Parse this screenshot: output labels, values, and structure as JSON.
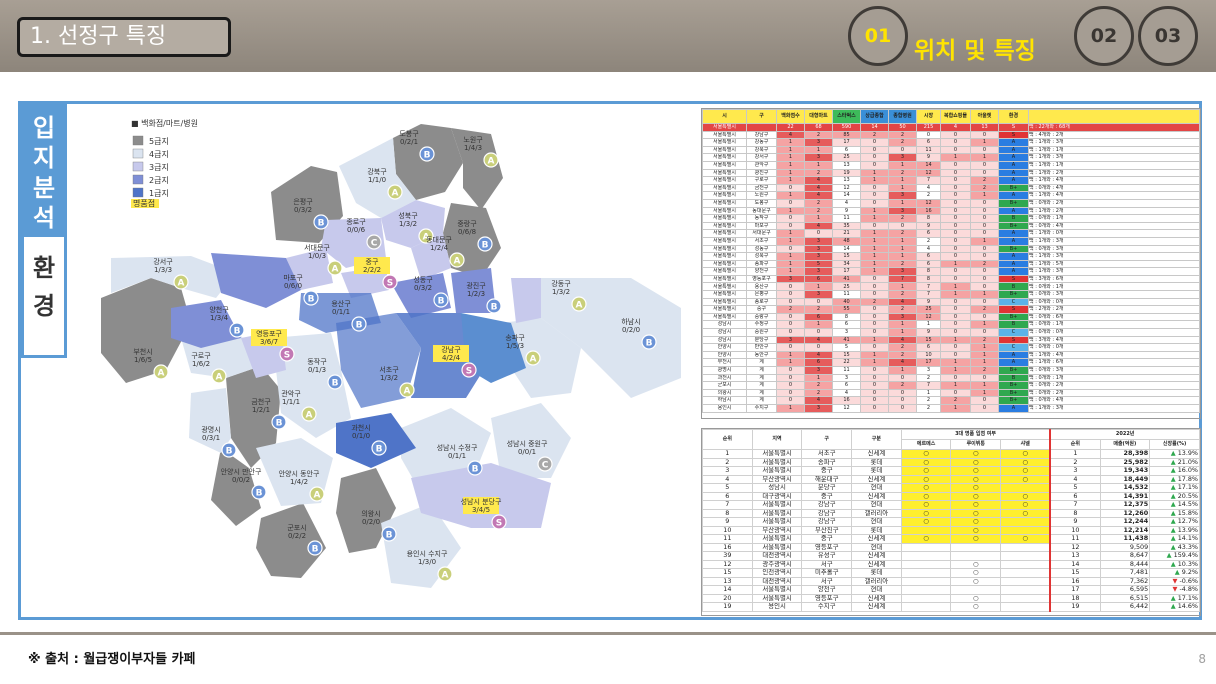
{
  "header": {
    "title": "1. 선정구 특징",
    "steps": [
      "01",
      "02",
      "03"
    ],
    "active_label": "위치 및 특징"
  },
  "side_tabs": [
    "입지분석",
    "환경"
  ],
  "legend": {
    "title": "■ 백화점/마트/병원",
    "levels": [
      {
        "label": "5급지",
        "color": "#8c8c8c"
      },
      {
        "label": "4급지",
        "color": "#dbe4f0"
      },
      {
        "label": "3급지",
        "color": "#c7c9ec"
      },
      {
        "label": "2급지",
        "color": "#7f8fd6"
      },
      {
        "label": "1급지",
        "color": "#4f74c8"
      }
    ],
    "selected": "명품점"
  },
  "districts": [
    {
      "name": "도봉구",
      "counts": "0/2/1",
      "grade": "B"
    },
    {
      "name": "노원구",
      "counts": "1/4/3",
      "grade": "A"
    },
    {
      "name": "강북구",
      "counts": "1/1/0",
      "grade": "A"
    },
    {
      "name": "은평구",
      "counts": "0/3/2",
      "grade": "B"
    },
    {
      "name": "성북구",
      "counts": "1/3/2",
      "grade": "A"
    },
    {
      "name": "중랑구",
      "counts": "0/6/8",
      "grade": "B"
    },
    {
      "name": "종로구",
      "counts": "0/0/6",
      "grade": "C"
    },
    {
      "name": "동대문구",
      "counts": "1/2/4",
      "grade": "A"
    },
    {
      "name": "서대문구",
      "counts": "1/0/3",
      "grade": "A"
    },
    {
      "name": "중구",
      "counts": "2/2/2",
      "grade": "S"
    },
    {
      "name": "강서구",
      "counts": "1/3/3",
      "grade": "A"
    },
    {
      "name": "마포구",
      "counts": "0/6/0",
      "grade": "B"
    },
    {
      "name": "성동구",
      "counts": "0/3/2",
      "grade": "B"
    },
    {
      "name": "광진구",
      "counts": "1/2/3",
      "grade": "B"
    },
    {
      "name": "강동구",
      "counts": "1/3/2",
      "grade": "A"
    },
    {
      "name": "용산구",
      "counts": "0/1/1",
      "grade": "B"
    },
    {
      "name": "하남시",
      "counts": "0/2/0",
      "grade": "B"
    },
    {
      "name": "양천구",
      "counts": "1/3/4",
      "grade": "B"
    },
    {
      "name": "영등포구",
      "counts": "3/6/7",
      "grade": "S"
    },
    {
      "name": "부천시",
      "counts": "1/6/5",
      "grade": "A"
    },
    {
      "name": "구로구",
      "counts": "1/6/2",
      "grade": "A"
    },
    {
      "name": "동작구",
      "counts": "0/1/3",
      "grade": "B"
    },
    {
      "name": "송파구",
      "counts": "1/5/3",
      "grade": "A"
    },
    {
      "name": "강남구",
      "counts": "4/2/4",
      "grade": "S"
    },
    {
      "name": "서초구",
      "counts": "1/3/2",
      "grade": "A"
    },
    {
      "name": "관악구",
      "counts": "1/1/1",
      "grade": "A"
    },
    {
      "name": "광명시",
      "counts": "0/3/1",
      "grade": "B"
    },
    {
      "name": "금천구",
      "counts": "1/2/1",
      "grade": "B"
    },
    {
      "name": "과천시",
      "counts": "0/1/0",
      "grade": "B"
    },
    {
      "name": "안양시 만안구",
      "counts": "0/0/2",
      "grade": "B"
    },
    {
      "name": "안양시 동안구",
      "counts": "1/4/2",
      "grade": "A"
    },
    {
      "name": "성남시 수정구",
      "counts": "0/1/1",
      "grade": "B"
    },
    {
      "name": "성남시 중원구",
      "counts": "0/0/1",
      "grade": "C"
    },
    {
      "name": "성남시 분당구",
      "counts": "3/4/5",
      "grade": "S"
    },
    {
      "name": "의왕시",
      "counts": "0/2/0",
      "grade": "B"
    },
    {
      "name": "군포시",
      "counts": "0/2/2",
      "grade": "B"
    },
    {
      "name": "용인시 수지구",
      "counts": "1/3/0",
      "grade": "A"
    }
  ],
  "table1": {
    "headers": [
      "시",
      "구",
      "백화점수",
      "대형마트",
      "스타벅스",
      "상급종합",
      "종합병원",
      "시장",
      "복합쇼핑몰",
      "아울렛",
      "환경",
      ""
    ],
    "rows": [
      [
        "서울특별시",
        "",
        "22",
        "68",
        "590",
        "14",
        "50",
        "215",
        "4",
        "13",
        "S",
        "백 : 22개와 : 68개"
      ],
      [
        "서울특별시",
        "강남구",
        "4",
        "2",
        "85",
        "2",
        "2",
        "0",
        "0",
        "0",
        "S",
        "백 : 4개와 : 2개"
      ],
      [
        "서울특별시",
        "강동구",
        "1",
        "3",
        "17",
        "0",
        "2",
        "6",
        "0",
        "1",
        "A",
        "백 : 1개와 : 3개"
      ],
      [
        "서울특별시",
        "강북구",
        "1",
        "1",
        "6",
        "0",
        "0",
        "11",
        "0",
        "0",
        "A",
        "백 : 1개와 : 1개"
      ],
      [
        "서울특별시",
        "강서구",
        "1",
        "3",
        "25",
        "0",
        "3",
        "9",
        "1",
        "1",
        "A",
        "백 : 1개와 : 3개"
      ],
      [
        "서울특별시",
        "관악구",
        "1",
        "1",
        "13",
        "0",
        "1",
        "14",
        "0",
        "0",
        "A",
        "백 : 1개와 : 1개"
      ],
      [
        "서울특별시",
        "광진구",
        "1",
        "2",
        "19",
        "1",
        "2",
        "12",
        "0",
        "0",
        "A",
        "백 : 1개와 : 2개"
      ],
      [
        "서울특별시",
        "구로구",
        "1",
        "4",
        "13",
        "1",
        "1",
        "7",
        "0",
        "2",
        "A",
        "백 : 1개와 : 4개"
      ],
      [
        "서울특별시",
        "금천구",
        "0",
        "4",
        "12",
        "0",
        "1",
        "4",
        "0",
        "2",
        "B+",
        "백 : 0개와 : 4개"
      ],
      [
        "서울특별시",
        "노원구",
        "1",
        "4",
        "14",
        "0",
        "3",
        "2",
        "0",
        "1",
        "A",
        "백 : 1개와 : 4개"
      ],
      [
        "서울특별시",
        "도봉구",
        "0",
        "2",
        "4",
        "0",
        "1",
        "12",
        "0",
        "0",
        "B+",
        "백 : 0개와 : 2개"
      ],
      [
        "서울특별시",
        "동대문구",
        "1",
        "2",
        "9",
        "1",
        "3",
        "16",
        "0",
        "0",
        "A",
        "백 : 1개와 : 2개"
      ],
      [
        "서울특별시",
        "동작구",
        "0",
        "1",
        "11",
        "1",
        "2",
        "8",
        "0",
        "0",
        "B",
        "백 : 0개와 : 1개"
      ],
      [
        "서울특별시",
        "마포구",
        "0",
        "4",
        "35",
        "0",
        "0",
        "9",
        "0",
        "0",
        "B+",
        "백 : 0개와 : 4개"
      ],
      [
        "서울특별시",
        "서대문구",
        "1",
        "0",
        "21",
        "1",
        "2",
        "6",
        "0",
        "0",
        "A",
        "백 : 1개와 : 0개"
      ],
      [
        "서울특별시",
        "서초구",
        "1",
        "3",
        "48",
        "1",
        "1",
        "2",
        "0",
        "1",
        "A",
        "백 : 1개와 : 3개"
      ],
      [
        "서울특별시",
        "성동구",
        "0",
        "3",
        "14",
        "1",
        "1",
        "4",
        "0",
        "0",
        "B+",
        "백 : 0개와 : 3개"
      ],
      [
        "서울특별시",
        "성북구",
        "1",
        "3",
        "15",
        "1",
        "1",
        "6",
        "0",
        "0",
        "A",
        "백 : 1개와 : 3개"
      ],
      [
        "서울특별시",
        "송파구",
        "1",
        "5",
        "34",
        "1",
        "2",
        "6",
        "1",
        "2",
        "A",
        "백 : 1개와 : 5개"
      ],
      [
        "서울특별시",
        "양천구",
        "1",
        "3",
        "17",
        "1",
        "3",
        "8",
        "0",
        "0",
        "A",
        "백 : 1개와 : 3개"
      ],
      [
        "서울특별시",
        "영등포구",
        "3",
        "6",
        "41",
        "0",
        "7",
        "8",
        "0",
        "0",
        "S",
        "백 : 3개와 : 6개"
      ],
      [
        "서울특별시",
        "용산구",
        "0",
        "1",
        "25",
        "0",
        "1",
        "7",
        "1",
        "0",
        "B",
        "백 : 0개와 : 1개"
      ],
      [
        "서울특별시",
        "은평구",
        "0",
        "3",
        "11",
        "0",
        "2",
        "7",
        "1",
        "1",
        "B+",
        "백 : 0개와 : 3개"
      ],
      [
        "서울특별시",
        "종로구",
        "0",
        "0",
        "40",
        "2",
        "4",
        "9",
        "0",
        "0",
        "C",
        "백 : 0개와 : 0개"
      ],
      [
        "서울특별시",
        "중구",
        "2",
        "2",
        "55",
        "0",
        "2",
        "25",
        "0",
        "2",
        "S",
        "백 : 2개와 : 2개"
      ],
      [
        "서울특별시",
        "중랑구",
        "0",
        "6",
        "8",
        "0",
        "3",
        "12",
        "0",
        "0",
        "B+",
        "백 : 0개와 : 6개"
      ],
      [
        "성남시",
        "수정구",
        "0",
        "1",
        "6",
        "0",
        "1",
        "1",
        "0",
        "1",
        "B",
        "백 : 0개와 : 1개"
      ],
      [
        "성남시",
        "중원구",
        "0",
        "0",
        "3",
        "0",
        "1",
        "9",
        "0",
        "0",
        "C",
        "백 : 0개와 : 0개"
      ],
      [
        "성남시",
        "분당구",
        "3",
        "4",
        "41",
        "1",
        "4",
        "15",
        "1",
        "2",
        "S",
        "백 : 3개와 : 4개"
      ],
      [
        "안양시",
        "만안구",
        "0",
        "0",
        "5",
        "0",
        "2",
        "6",
        "0",
        "1",
        "C",
        "백 : 0개와 : 0개"
      ],
      [
        "안양시",
        "동안구",
        "1",
        "4",
        "15",
        "1",
        "2",
        "10",
        "0",
        "1",
        "A",
        "백 : 1개와 : 4개"
      ],
      [
        "부천시",
        "계",
        "1",
        "6",
        "22",
        "1",
        "4",
        "17",
        "1",
        "1",
        "A",
        "백 : 1개와 : 6개"
      ],
      [
        "광명시",
        "계",
        "0",
        "3",
        "11",
        "0",
        "1",
        "3",
        "1",
        "2",
        "B+",
        "백 : 0개와 : 3개"
      ],
      [
        "과천시",
        "계",
        "0",
        "1",
        "3",
        "0",
        "0",
        "2",
        "0",
        "0",
        "B",
        "백 : 0개와 : 1개"
      ],
      [
        "군포시",
        "계",
        "0",
        "2",
        "6",
        "0",
        "2",
        "7",
        "1",
        "1",
        "B+",
        "백 : 0개와 : 2개"
      ],
      [
        "의왕시",
        "계",
        "0",
        "2",
        "4",
        "0",
        "0",
        "1",
        "0",
        "1",
        "B+",
        "백 : 0개와 : 2개"
      ],
      [
        "하남시",
        "계",
        "0",
        "4",
        "16",
        "0",
        "0",
        "2",
        "2",
        "0",
        "B+",
        "백 : 0개와 : 4개"
      ],
      [
        "용인시",
        "수지구",
        "1",
        "3",
        "12",
        "0",
        "0",
        "2",
        "1",
        "0",
        "A",
        "백 : 1개와 : 3개"
      ]
    ]
  },
  "table2": {
    "group_header": "3대 명품 입점 여부",
    "year_header": "2022년",
    "headers": [
      "순위",
      "지역",
      "구",
      "구분",
      "에르메스",
      "루이뷔통",
      "샤넬",
      "순위",
      "매출(억원)",
      "신장률(%)"
    ],
    "mark": "○",
    "rows": [
      [
        "1",
        "서울특별시",
        "서초구",
        "신세계",
        "○",
        "○",
        "○",
        "1",
        "28,398",
        "13.9%",
        "up"
      ],
      [
        "2",
        "서울특별시",
        "송파구",
        "롯데",
        "○",
        "○",
        "○",
        "2",
        "25,982",
        "21.0%",
        "up"
      ],
      [
        "3",
        "서울특별시",
        "중구",
        "롯데",
        "○",
        "○",
        "○",
        "3",
        "19,343",
        "16.0%",
        "up"
      ],
      [
        "4",
        "부산광역시",
        "해운대구",
        "신세계",
        "○",
        "○",
        "○",
        "4",
        "18,449",
        "17.8%",
        "up"
      ],
      [
        "5",
        "성남시",
        "분당구",
        "현대",
        "○",
        "○",
        "",
        "5",
        "14,532",
        "17.1%",
        "up"
      ],
      [
        "6",
        "대구광역시",
        "중구",
        "신세계",
        "○",
        "○",
        "○",
        "6",
        "14,391",
        "20.5%",
        "up"
      ],
      [
        "7",
        "서울특별시",
        "강남구",
        "현대",
        "○",
        "○",
        "○",
        "7",
        "12,375",
        "14.5%",
        "up"
      ],
      [
        "8",
        "서울특별시",
        "강남구",
        "갤러리아",
        "○",
        "○",
        "○",
        "8",
        "12,260",
        "15.8%",
        "up"
      ],
      [
        "9",
        "서울특별시",
        "강남구",
        "현대",
        "○",
        "○",
        "",
        "9",
        "12,244",
        "12.7%",
        "up"
      ],
      [
        "10",
        "부산광역시",
        "부산진구",
        "롯데",
        "",
        "○",
        "",
        "10",
        "12,214",
        "13.9%",
        "up"
      ],
      [
        "11",
        "서울특별시",
        "중구",
        "신세계",
        "○",
        "○",
        "○",
        "11",
        "11,438",
        "14.1%",
        "up"
      ],
      [
        "16",
        "서울특별시",
        "영등포구",
        "현대",
        "",
        "",
        "",
        "12",
        "9,509",
        "43.3%",
        "up"
      ],
      [
        "39",
        "대전광역시",
        "유성구",
        "신세계",
        "",
        "",
        "",
        "13",
        "8,647",
        "159.4%",
        "up"
      ],
      [
        "12",
        "광주광역시",
        "서구",
        "신세계",
        "",
        "○",
        "",
        "14",
        "8,444",
        "10.3%",
        "up"
      ],
      [
        "15",
        "인천광역시",
        "미추홀구",
        "롯데",
        "",
        "○",
        "",
        "15",
        "7,481",
        "9.2%",
        "up"
      ],
      [
        "13",
        "대전광역시",
        "서구",
        "갤러리아",
        "",
        "○",
        "",
        "16",
        "7,362",
        "-0.6%",
        "dn"
      ],
      [
        "14",
        "서울특별시",
        "양천구",
        "현대",
        "",
        "",
        "",
        "17",
        "6,595",
        "-4.8%",
        "dn"
      ],
      [
        "20",
        "서울특별시",
        "영등포구",
        "신세계",
        "",
        "○",
        "",
        "18",
        "6,515",
        "17.1%",
        "up"
      ],
      [
        "19",
        "용인시",
        "수지구",
        "신세계",
        "",
        "○",
        "",
        "19",
        "6,442",
        "14.6%",
        "up"
      ]
    ]
  },
  "footer": {
    "source": "※ 출처 : 월급쟁이부자들 카페",
    "page": "8"
  },
  "colors": {
    "accent": "#5b9bd5",
    "highlight": "#ffe400",
    "grade_S": "#e03434",
    "grade_A": "#2a7de1",
    "grade_B": "#2fa84f"
  }
}
